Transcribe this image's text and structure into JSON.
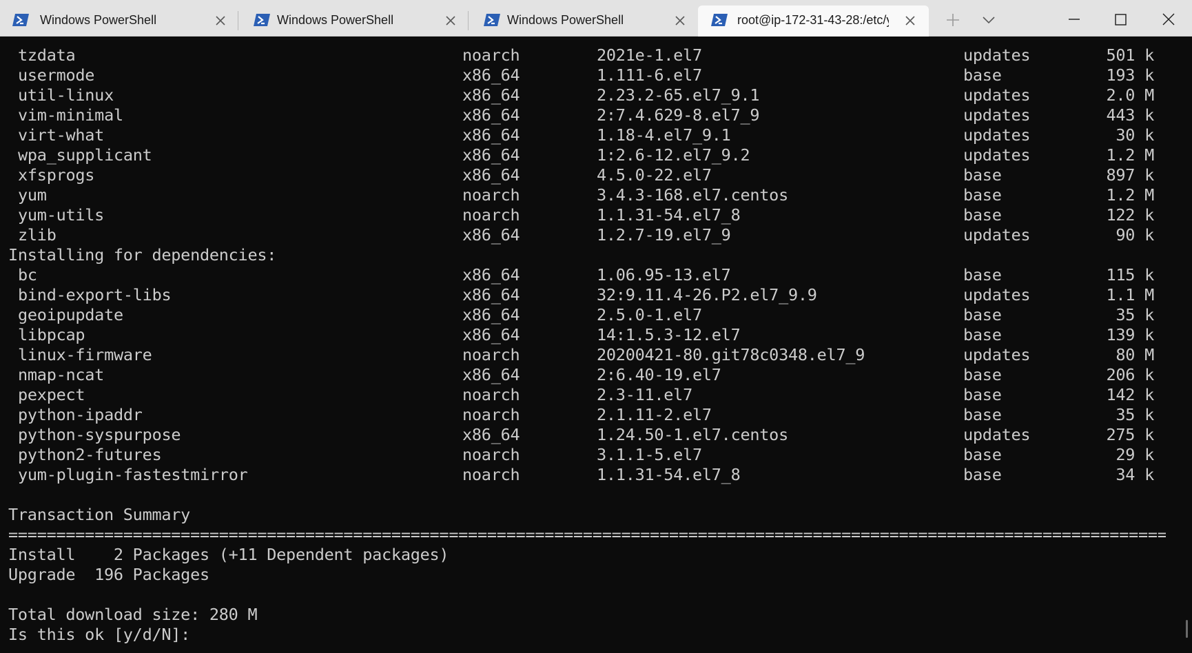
{
  "tabs": [
    {
      "title": "Windows PowerShell",
      "active": false
    },
    {
      "title": "Windows PowerShell",
      "active": false
    },
    {
      "title": "Windows PowerShell",
      "active": false
    },
    {
      "title": "root@ip-172-31-43-28:/etc/y",
      "active": true
    }
  ],
  "titlebar": {
    "new_tab_icon": "plus-icon",
    "dropdown_icon": "chevron-down-icon",
    "minimize_icon": "minimize-icon",
    "maximize_icon": "maximize-icon",
    "close_icon": "close-icon"
  },
  "colors": {
    "terminal_bg": "#0c0c0c",
    "terminal_fg": "#cccccc",
    "tabbar_bg": "#e3e3e3",
    "active_tab_bg": "#f9f9f9",
    "powershell_icon": "#2b5fb4"
  },
  "terminal": {
    "packages_top": [
      {
        "name": "tzdata",
        "arch": "noarch",
        "version": "2021e-1.el7",
        "repo": "updates",
        "size": "501 k"
      },
      {
        "name": "usermode",
        "arch": "x86_64",
        "version": "1.111-6.el7",
        "repo": "base",
        "size": "193 k"
      },
      {
        "name": "util-linux",
        "arch": "x86_64",
        "version": "2.23.2-65.el7_9.1",
        "repo": "updates",
        "size": "2.0 M"
      },
      {
        "name": "vim-minimal",
        "arch": "x86_64",
        "version": "2:7.4.629-8.el7_9",
        "repo": "updates",
        "size": "443 k"
      },
      {
        "name": "virt-what",
        "arch": "x86_64",
        "version": "1.18-4.el7_9.1",
        "repo": "updates",
        "size": "30 k"
      },
      {
        "name": "wpa_supplicant",
        "arch": "x86_64",
        "version": "1:2.6-12.el7_9.2",
        "repo": "updates",
        "size": "1.2 M"
      },
      {
        "name": "xfsprogs",
        "arch": "x86_64",
        "version": "4.5.0-22.el7",
        "repo": "base",
        "size": "897 k"
      },
      {
        "name": "yum",
        "arch": "noarch",
        "version": "3.4.3-168.el7.centos",
        "repo": "base",
        "size": "1.2 M"
      },
      {
        "name": "yum-utils",
        "arch": "noarch",
        "version": "1.1.31-54.el7_8",
        "repo": "base",
        "size": "122 k"
      },
      {
        "name": "zlib",
        "arch": "x86_64",
        "version": "1.2.7-19.el7_9",
        "repo": "updates",
        "size": "90 k"
      }
    ],
    "deps_header": "Installing for dependencies:",
    "packages_deps": [
      {
        "name": "bc",
        "arch": "x86_64",
        "version": "1.06.95-13.el7",
        "repo": "base",
        "size": "115 k"
      },
      {
        "name": "bind-export-libs",
        "arch": "x86_64",
        "version": "32:9.11.4-26.P2.el7_9.9",
        "repo": "updates",
        "size": "1.1 M"
      },
      {
        "name": "geoipupdate",
        "arch": "x86_64",
        "version": "2.5.0-1.el7",
        "repo": "base",
        "size": "35 k"
      },
      {
        "name": "libpcap",
        "arch": "x86_64",
        "version": "14:1.5.3-12.el7",
        "repo": "base",
        "size": "139 k"
      },
      {
        "name": "linux-firmware",
        "arch": "noarch",
        "version": "20200421-80.git78c0348.el7_9",
        "repo": "updates",
        "size": "80 M"
      },
      {
        "name": "nmap-ncat",
        "arch": "x86_64",
        "version": "2:6.40-19.el7",
        "repo": "base",
        "size": "206 k"
      },
      {
        "name": "pexpect",
        "arch": "noarch",
        "version": "2.3-11.el7",
        "repo": "base",
        "size": "142 k"
      },
      {
        "name": "python-ipaddr",
        "arch": "noarch",
        "version": "2.1.11-2.el7",
        "repo": "base",
        "size": "35 k"
      },
      {
        "name": "python-syspurpose",
        "arch": "x86_64",
        "version": "1.24.50-1.el7.centos",
        "repo": "updates",
        "size": "275 k"
      },
      {
        "name": "python2-futures",
        "arch": "noarch",
        "version": "3.1.1-5.el7",
        "repo": "base",
        "size": "29 k"
      },
      {
        "name": "yum-plugin-fastestmirror",
        "arch": "noarch",
        "version": "1.1.31-54.el7_8",
        "repo": "base",
        "size": "34 k"
      }
    ],
    "summary_title": "Transaction Summary",
    "separator": "================================================================================================================================",
    "install_line": "Install    2 Packages (+11 Dependent packages)",
    "upgrade_line": "Upgrade  196 Packages",
    "download_size": "Total download size: 280 M",
    "prompt": "Is this ok [y/d/N]: "
  }
}
